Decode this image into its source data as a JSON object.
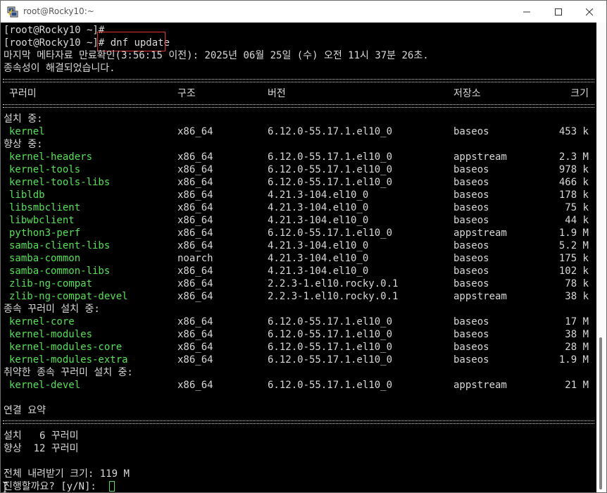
{
  "window": {
    "title": "root@Rocky10:~",
    "controls": {
      "minimize": "minimize",
      "maximize": "maximize",
      "close": "close"
    }
  },
  "terminal": {
    "prompt1": "[root@Rocky10 ~]#",
    "prompt2": "[root@Rocky10 ~]#",
    "command": " dnf update",
    "metadata_line": "마지막 메타자료 만료확인(3:56:15 이전): 2025년 06월 25일 (수) 오전 11시 37분 26초.",
    "deps_resolved": "종속성이 해결되었습니다.",
    "table_header": {
      "package": "꾸러미",
      "arch": "구조",
      "version": "버전",
      "repo": "저장소",
      "size": "크기"
    },
    "sections": {
      "installing": "설치 중:",
      "upgrading": "향상 중:",
      "installing_deps": "종속 꾸러미 설치 중:",
      "installing_weak_deps": "취약한 종속 꾸러미 설치 중:"
    },
    "installing_rows": [
      {
        "name": "kernel",
        "arch": "x86_64",
        "version": "6.12.0-55.17.1.el10_0",
        "repo": "baseos",
        "size": "453 k"
      }
    ],
    "upgrading_rows": [
      {
        "name": "kernel-headers",
        "arch": "x86_64",
        "version": "6.12.0-55.17.1.el10_0",
        "repo": "appstream",
        "size": "2.3 M"
      },
      {
        "name": "kernel-tools",
        "arch": "x86_64",
        "version": "6.12.0-55.17.1.el10_0",
        "repo": "baseos",
        "size": "978 k"
      },
      {
        "name": "kernel-tools-libs",
        "arch": "x86_64",
        "version": "6.12.0-55.17.1.el10_0",
        "repo": "baseos",
        "size": "466 k"
      },
      {
        "name": "libldb",
        "arch": "x86_64",
        "version": "4.21.3-104.el10_0",
        "repo": "baseos",
        "size": "178 k"
      },
      {
        "name": "libsmbclient",
        "arch": "x86_64",
        "version": "4.21.3-104.el10_0",
        "repo": "baseos",
        "size": "75 k"
      },
      {
        "name": "libwbclient",
        "arch": "x86_64",
        "version": "4.21.3-104.el10_0",
        "repo": "baseos",
        "size": "44 k"
      },
      {
        "name": "python3-perf",
        "arch": "x86_64",
        "version": "6.12.0-55.17.1.el10_0",
        "repo": "appstream",
        "size": "1.9 M"
      },
      {
        "name": "samba-client-libs",
        "arch": "x86_64",
        "version": "4.21.3-104.el10_0",
        "repo": "baseos",
        "size": "5.2 M"
      },
      {
        "name": "samba-common",
        "arch": "noarch",
        "version": "4.21.3-104.el10_0",
        "repo": "baseos",
        "size": "175 k"
      },
      {
        "name": "samba-common-libs",
        "arch": "x86_64",
        "version": "4.21.3-104.el10_0",
        "repo": "baseos",
        "size": "102 k"
      },
      {
        "name": "zlib-ng-compat",
        "arch": "x86_64",
        "version": "2.2.3-1.el10.rocky.0.1",
        "repo": "baseos",
        "size": "78 k"
      },
      {
        "name": "zlib-ng-compat-devel",
        "arch": "x86_64",
        "version": "2.2.3-1.el10.rocky.0.1",
        "repo": "appstream",
        "size": "38 k"
      }
    ],
    "deps_rows": [
      {
        "name": "kernel-core",
        "arch": "x86_64",
        "version": "6.12.0-55.17.1.el10_0",
        "repo": "baseos",
        "size": "17 M"
      },
      {
        "name": "kernel-modules",
        "arch": "x86_64",
        "version": "6.12.0-55.17.1.el10_0",
        "repo": "baseos",
        "size": "38 M"
      },
      {
        "name": "kernel-modules-core",
        "arch": "x86_64",
        "version": "6.12.0-55.17.1.el10_0",
        "repo": "baseos",
        "size": "28 M"
      },
      {
        "name": "kernel-modules-extra",
        "arch": "x86_64",
        "version": "6.12.0-55.17.1.el10_0",
        "repo": "baseos",
        "size": "1.9 M"
      }
    ],
    "weak_deps_rows": [
      {
        "name": "kernel-devel",
        "arch": "x86_64",
        "version": "6.12.0-55.17.1.el10_0",
        "repo": "appstream",
        "size": "21 M"
      }
    ],
    "summary_title": "연결 요약",
    "summary_install": "설치   6 꾸러미",
    "summary_upgrade": "향상  12 꾸러미",
    "total_download": "전체 내려받기 크기: 119 M",
    "confirm_prompt": "진행할까요? [y/N]: ",
    "colors": {
      "package_name": "#54e154",
      "text": "#d8d8d8",
      "background": "#000000",
      "highlight_box": "#e03030"
    }
  }
}
